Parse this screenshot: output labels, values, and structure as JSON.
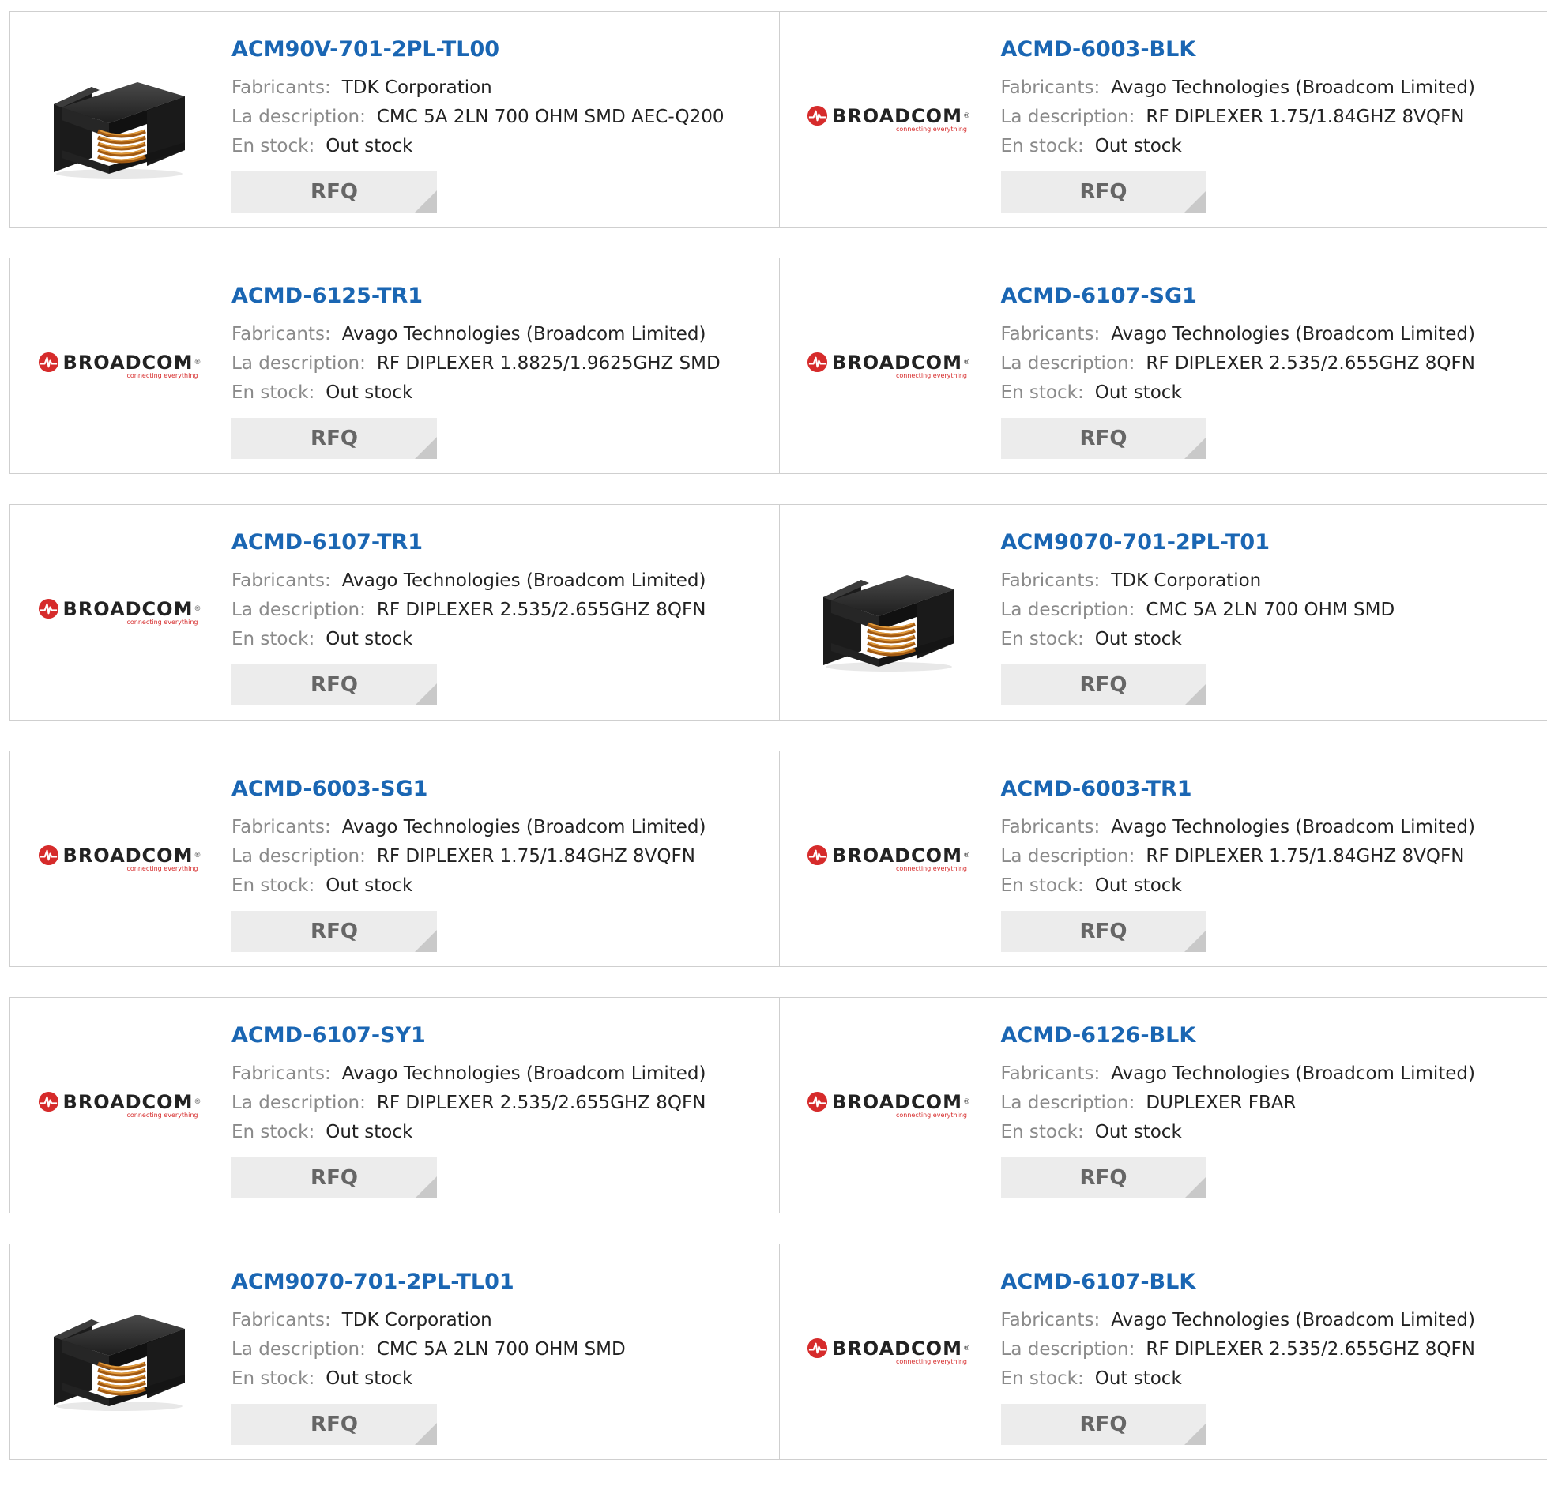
{
  "labels": {
    "manufacturer": "Fabricants:",
    "description": "La description:",
    "stock": "En stock:",
    "rfq": "RFQ"
  },
  "broadcom_logo": {
    "wordmark": "BROADCOM",
    "tagline": "connecting everything"
  },
  "colors": {
    "part_link": "#1a66b3",
    "label_gray": "#8a8a8a",
    "button_bg": "#ececec",
    "broadcom_red": "#d62b2b"
  },
  "products": [
    {
      "part": "ACM90V-701-2PL-TL00",
      "manufacturer": "TDK Corporation",
      "description": "CMC 5A 2LN 700 OHM SMD AEC-Q200",
      "stock": "Out stock",
      "image": "inductor-chip"
    },
    {
      "part": "ACMD-6003-BLK",
      "manufacturer": "Avago Technologies (Broadcom Limited)",
      "description": "RF DIPLEXER 1.75/1.84GHZ 8VQFN",
      "stock": "Out stock",
      "image": "broadcom-logo"
    },
    {
      "part": "ACMD-6125-TR1",
      "manufacturer": "Avago Technologies (Broadcom Limited)",
      "description": "RF DIPLEXER 1.8825/1.9625GHZ SMD",
      "stock": "Out stock",
      "image": "broadcom-logo"
    },
    {
      "part": "ACMD-6107-SG1",
      "manufacturer": "Avago Technologies (Broadcom Limited)",
      "description": "RF DIPLEXER 2.535/2.655GHZ 8QFN",
      "stock": "Out stock",
      "image": "broadcom-logo"
    },
    {
      "part": "ACMD-6107-TR1",
      "manufacturer": "Avago Technologies (Broadcom Limited)",
      "description": "RF DIPLEXER 2.535/2.655GHZ 8QFN",
      "stock": "Out stock",
      "image": "broadcom-logo"
    },
    {
      "part": "ACM9070-701-2PL-T01",
      "manufacturer": "TDK Corporation",
      "description": "CMC 5A 2LN 700 OHM SMD",
      "stock": "Out stock",
      "image": "inductor-chip"
    },
    {
      "part": "ACMD-6003-SG1",
      "manufacturer": "Avago Technologies (Broadcom Limited)",
      "description": "RF DIPLEXER 1.75/1.84GHZ 8VQFN",
      "stock": "Out stock",
      "image": "broadcom-logo"
    },
    {
      "part": "ACMD-6003-TR1",
      "manufacturer": "Avago Technologies (Broadcom Limited)",
      "description": "RF DIPLEXER 1.75/1.84GHZ 8VQFN",
      "stock": "Out stock",
      "image": "broadcom-logo"
    },
    {
      "part": "ACMD-6107-SY1",
      "manufacturer": "Avago Technologies (Broadcom Limited)",
      "description": "RF DIPLEXER 2.535/2.655GHZ 8QFN",
      "stock": "Out stock",
      "image": "broadcom-logo"
    },
    {
      "part": "ACMD-6126-BLK",
      "manufacturer": "Avago Technologies (Broadcom Limited)",
      "description": "DUPLEXER FBAR",
      "stock": "Out stock",
      "image": "broadcom-logo"
    },
    {
      "part": "ACM9070-701-2PL-TL01",
      "manufacturer": "TDK Corporation",
      "description": "CMC 5A 2LN 700 OHM SMD",
      "stock": "Out stock",
      "image": "inductor-chip"
    },
    {
      "part": "ACMD-6107-BLK",
      "manufacturer": "Avago Technologies (Broadcom Limited)",
      "description": "RF DIPLEXER 2.535/2.655GHZ 8QFN",
      "stock": "Out stock",
      "image": "broadcom-logo"
    }
  ]
}
